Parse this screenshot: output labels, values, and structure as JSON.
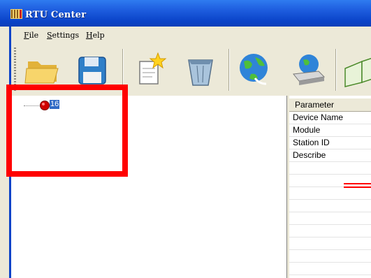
{
  "window": {
    "title": "RTU Center"
  },
  "menu": {
    "items": [
      "File",
      "Settings",
      "Help"
    ]
  },
  "toolbar": {
    "buttons": [
      "open-folder-icon",
      "save-disk-icon",
      "new-document-icon",
      "delete-bin-icon",
      "connect-globe-icon",
      "network-device-icon",
      "open-book-icon"
    ]
  },
  "tree": {
    "node_label": "16"
  },
  "grid": {
    "header": "Parameter",
    "rows": [
      "Device Name",
      "Module",
      "Station ID",
      "Describe"
    ]
  },
  "colors": {
    "titlebar": "#0a43c8",
    "selection": "#316ac5",
    "annotation": "#ff0000"
  }
}
